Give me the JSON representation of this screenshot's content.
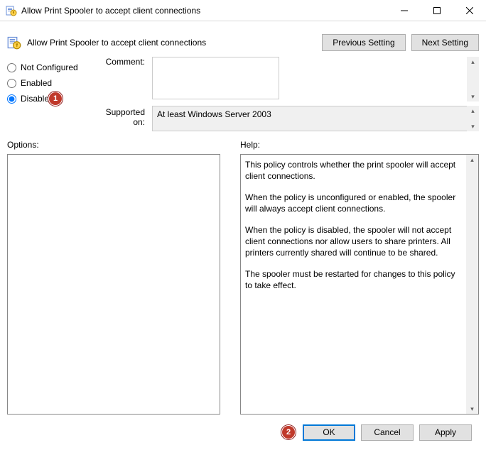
{
  "titlebar": {
    "title": "Allow Print Spooler to accept client connections"
  },
  "header": {
    "policy_title": "Allow Print Spooler to accept client connections",
    "prev_btn": "Previous Setting",
    "next_btn": "Next Setting"
  },
  "radios": {
    "not_configured": "Not Configured",
    "enabled": "Enabled",
    "disabled": "Disabled",
    "selected": "disabled"
  },
  "comment": {
    "label": "Comment:",
    "value": ""
  },
  "supported": {
    "label": "Supported on:",
    "value": "At least Windows Server 2003"
  },
  "options": {
    "label": "Options:"
  },
  "help": {
    "label": "Help:",
    "p1": "This policy controls whether the print spooler will accept client connections.",
    "p2": "When the policy is unconfigured or enabled, the spooler will always accept client connections.",
    "p3": "When the policy is disabled, the spooler will not accept client connections nor allow users to share printers.  All printers currently shared will continue to be shared.",
    "p4": "The spooler must be restarted for changes to this policy to take effect."
  },
  "footer": {
    "ok": "OK",
    "cancel": "Cancel",
    "apply": "Apply"
  },
  "annotations": {
    "badge1": "1",
    "badge2": "2"
  }
}
